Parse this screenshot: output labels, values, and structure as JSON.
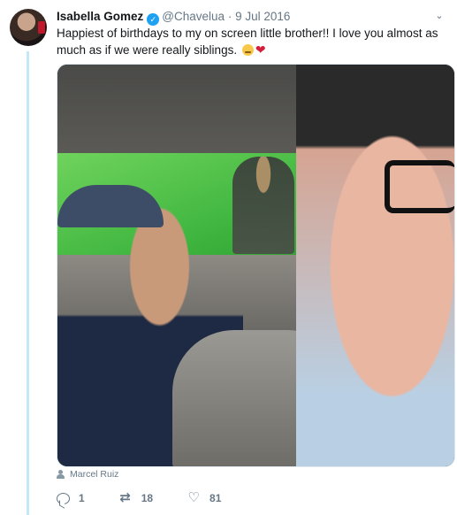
{
  "tweet": {
    "author_name": "Isabella Gomez",
    "handle": "@Chavelua",
    "separator": "·",
    "date": "9 Jul 2016",
    "text": "Happiest of birthdays to my on screen little brother!! I love you almost as much as if we were really siblings.",
    "emoji_1": "face-with-tongue",
    "emoji_2": "❤",
    "chevron": "⌄"
  },
  "media": {
    "credit_name": "Marcel Ruiz"
  },
  "actions": {
    "reply_count": "1",
    "retweet_count": "18",
    "like_count": "81",
    "reply_icon": "reply-icon",
    "retweet_icon": "⇄",
    "like_icon": "♡"
  },
  "colors": {
    "accent": "#1da1f2",
    "thread_line": "#c4e8f7",
    "secondary_text": "#657786"
  }
}
